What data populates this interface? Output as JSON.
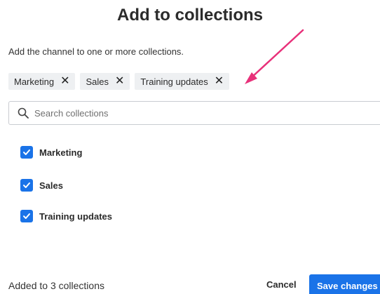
{
  "dialog": {
    "title": "Add to collections",
    "description": "Add the channel to one or more collections."
  },
  "chips": [
    {
      "label": "Marketing",
      "remove_icon": "close-icon"
    },
    {
      "label": "Sales",
      "remove_icon": "close-icon"
    },
    {
      "label": "Training updates",
      "remove_icon": "close-icon"
    }
  ],
  "search": {
    "placeholder": "Search collections",
    "value": "",
    "icon": "search-icon"
  },
  "options": [
    {
      "label": "Marketing",
      "checked": true
    },
    {
      "label": "Sales",
      "checked": true
    },
    {
      "label": "Training updates",
      "checked": true
    }
  ],
  "footer": {
    "status": "Added to 3 collections",
    "cancel_label": "Cancel",
    "save_label": "Save changes"
  },
  "colors": {
    "accent": "#1a73e8",
    "annotation_arrow": "#e8317a",
    "chip_background": "#eef0f2"
  }
}
